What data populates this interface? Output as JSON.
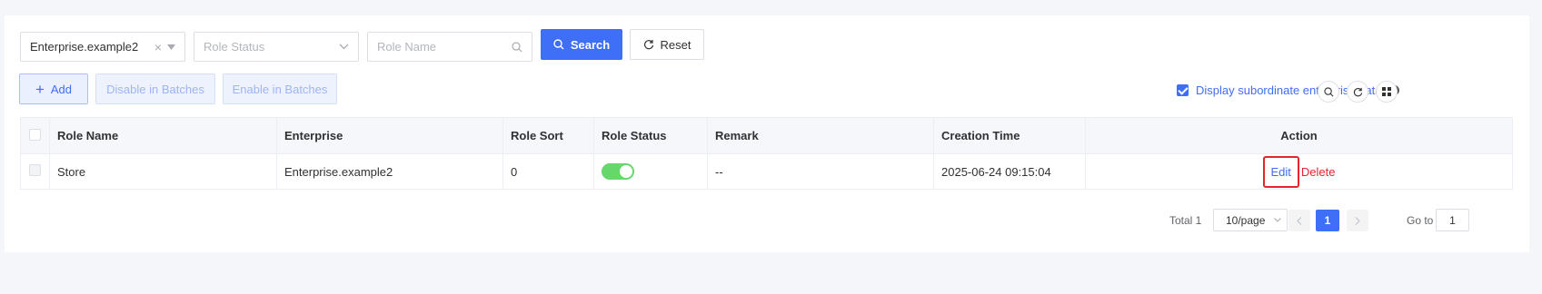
{
  "filters": {
    "enterprise": {
      "value": "Enterprise.example2"
    },
    "role_status": {
      "placeholder": "Role Status"
    },
    "role_name": {
      "placeholder": "Role Name"
    },
    "search_label": "Search",
    "reset_label": "Reset"
  },
  "toolbar": {
    "add_label": "Add",
    "disable_batches_label": "Disable in Batches",
    "enable_batches_label": "Enable in Batches",
    "subordinate_label": "Display subordinate enterprise data",
    "subordinate_checked": true
  },
  "table": {
    "columns": [
      "Role Name",
      "Enterprise",
      "Role Sort",
      "Role Status",
      "Remark",
      "Creation Time",
      "Action"
    ],
    "rows": [
      {
        "role_name": "Store",
        "enterprise": "Enterprise.example2",
        "role_sort": "0",
        "role_status_on": true,
        "remark": "--",
        "creation_time": "2025-06-24 09:15:04",
        "edit_label": "Edit",
        "delete_label": "Delete"
      }
    ]
  },
  "pagination": {
    "total_label": "Total 1",
    "page_size": "10/page",
    "current_page": "1",
    "goto_label": "Go to",
    "goto_value": "1"
  },
  "colors": {
    "primary": "#3f6ef7",
    "danger": "#e6242d",
    "switch_on": "#66d86b"
  }
}
